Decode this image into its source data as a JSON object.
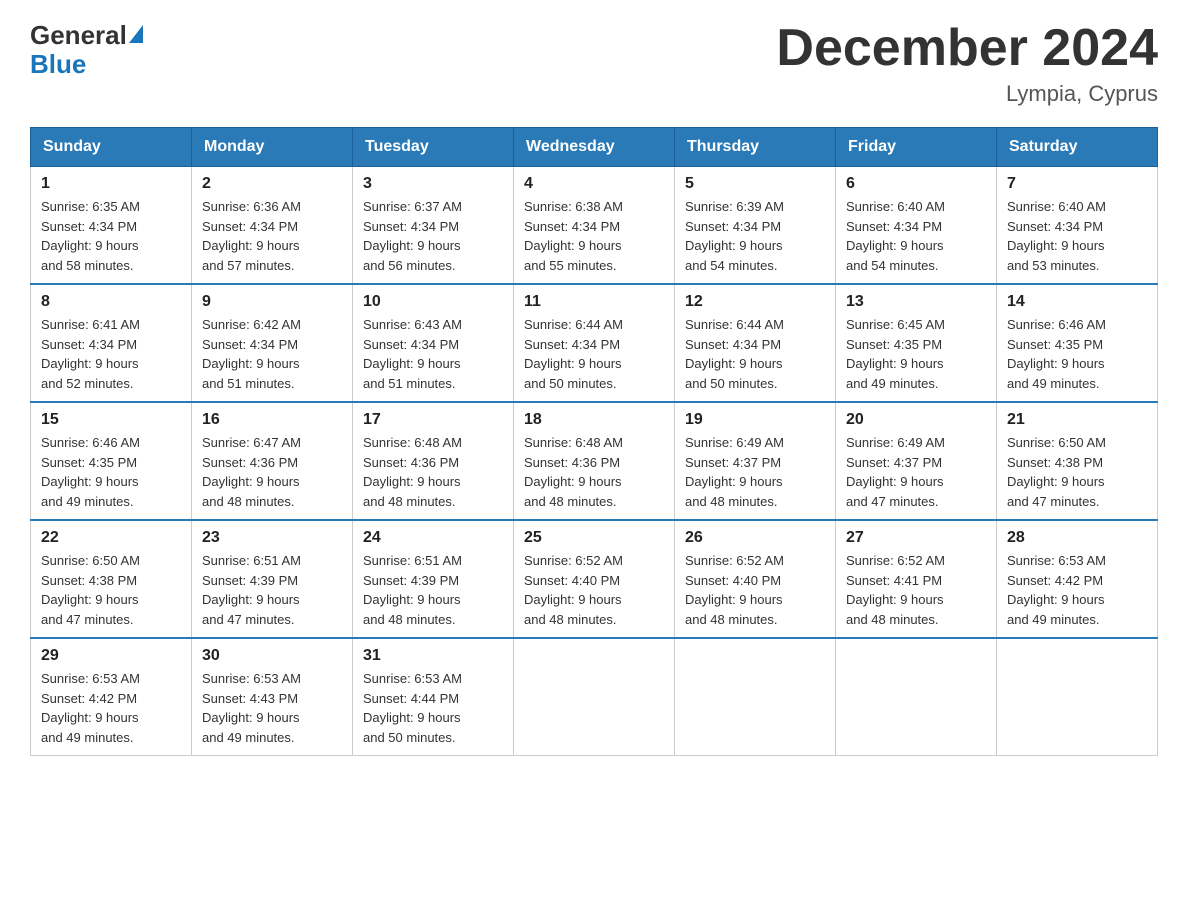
{
  "logo": {
    "general": "General",
    "blue": "Blue"
  },
  "header": {
    "month": "December 2024",
    "location": "Lympia, Cyprus"
  },
  "days_of_week": [
    "Sunday",
    "Monday",
    "Tuesday",
    "Wednesday",
    "Thursday",
    "Friday",
    "Saturday"
  ],
  "weeks": [
    [
      {
        "date": "1",
        "sunrise": "6:35 AM",
        "sunset": "4:34 PM",
        "daylight": "9 hours and 58 minutes."
      },
      {
        "date": "2",
        "sunrise": "6:36 AM",
        "sunset": "4:34 PM",
        "daylight": "9 hours and 57 minutes."
      },
      {
        "date": "3",
        "sunrise": "6:37 AM",
        "sunset": "4:34 PM",
        "daylight": "9 hours and 56 minutes."
      },
      {
        "date": "4",
        "sunrise": "6:38 AM",
        "sunset": "4:34 PM",
        "daylight": "9 hours and 55 minutes."
      },
      {
        "date": "5",
        "sunrise": "6:39 AM",
        "sunset": "4:34 PM",
        "daylight": "9 hours and 54 minutes."
      },
      {
        "date": "6",
        "sunrise": "6:40 AM",
        "sunset": "4:34 PM",
        "daylight": "9 hours and 54 minutes."
      },
      {
        "date": "7",
        "sunrise": "6:40 AM",
        "sunset": "4:34 PM",
        "daylight": "9 hours and 53 minutes."
      }
    ],
    [
      {
        "date": "8",
        "sunrise": "6:41 AM",
        "sunset": "4:34 PM",
        "daylight": "9 hours and 52 minutes."
      },
      {
        "date": "9",
        "sunrise": "6:42 AM",
        "sunset": "4:34 PM",
        "daylight": "9 hours and 51 minutes."
      },
      {
        "date": "10",
        "sunrise": "6:43 AM",
        "sunset": "4:34 PM",
        "daylight": "9 hours and 51 minutes."
      },
      {
        "date": "11",
        "sunrise": "6:44 AM",
        "sunset": "4:34 PM",
        "daylight": "9 hours and 50 minutes."
      },
      {
        "date": "12",
        "sunrise": "6:44 AM",
        "sunset": "4:34 PM",
        "daylight": "9 hours and 50 minutes."
      },
      {
        "date": "13",
        "sunrise": "6:45 AM",
        "sunset": "4:35 PM",
        "daylight": "9 hours and 49 minutes."
      },
      {
        "date": "14",
        "sunrise": "6:46 AM",
        "sunset": "4:35 PM",
        "daylight": "9 hours and 49 minutes."
      }
    ],
    [
      {
        "date": "15",
        "sunrise": "6:46 AM",
        "sunset": "4:35 PM",
        "daylight": "9 hours and 49 minutes."
      },
      {
        "date": "16",
        "sunrise": "6:47 AM",
        "sunset": "4:36 PM",
        "daylight": "9 hours and 48 minutes."
      },
      {
        "date": "17",
        "sunrise": "6:48 AM",
        "sunset": "4:36 PM",
        "daylight": "9 hours and 48 minutes."
      },
      {
        "date": "18",
        "sunrise": "6:48 AM",
        "sunset": "4:36 PM",
        "daylight": "9 hours and 48 minutes."
      },
      {
        "date": "19",
        "sunrise": "6:49 AM",
        "sunset": "4:37 PM",
        "daylight": "9 hours and 48 minutes."
      },
      {
        "date": "20",
        "sunrise": "6:49 AM",
        "sunset": "4:37 PM",
        "daylight": "9 hours and 47 minutes."
      },
      {
        "date": "21",
        "sunrise": "6:50 AM",
        "sunset": "4:38 PM",
        "daylight": "9 hours and 47 minutes."
      }
    ],
    [
      {
        "date": "22",
        "sunrise": "6:50 AM",
        "sunset": "4:38 PM",
        "daylight": "9 hours and 47 minutes."
      },
      {
        "date": "23",
        "sunrise": "6:51 AM",
        "sunset": "4:39 PM",
        "daylight": "9 hours and 47 minutes."
      },
      {
        "date": "24",
        "sunrise": "6:51 AM",
        "sunset": "4:39 PM",
        "daylight": "9 hours and 48 minutes."
      },
      {
        "date": "25",
        "sunrise": "6:52 AM",
        "sunset": "4:40 PM",
        "daylight": "9 hours and 48 minutes."
      },
      {
        "date": "26",
        "sunrise": "6:52 AM",
        "sunset": "4:40 PM",
        "daylight": "9 hours and 48 minutes."
      },
      {
        "date": "27",
        "sunrise": "6:52 AM",
        "sunset": "4:41 PM",
        "daylight": "9 hours and 48 minutes."
      },
      {
        "date": "28",
        "sunrise": "6:53 AM",
        "sunset": "4:42 PM",
        "daylight": "9 hours and 49 minutes."
      }
    ],
    [
      {
        "date": "29",
        "sunrise": "6:53 AM",
        "sunset": "4:42 PM",
        "daylight": "9 hours and 49 minutes."
      },
      {
        "date": "30",
        "sunrise": "6:53 AM",
        "sunset": "4:43 PM",
        "daylight": "9 hours and 49 minutes."
      },
      {
        "date": "31",
        "sunrise": "6:53 AM",
        "sunset": "4:44 PM",
        "daylight": "9 hours and 50 minutes."
      },
      null,
      null,
      null,
      null
    ]
  ],
  "labels": {
    "sunrise": "Sunrise:",
    "sunset": "Sunset:",
    "daylight": "Daylight:"
  }
}
